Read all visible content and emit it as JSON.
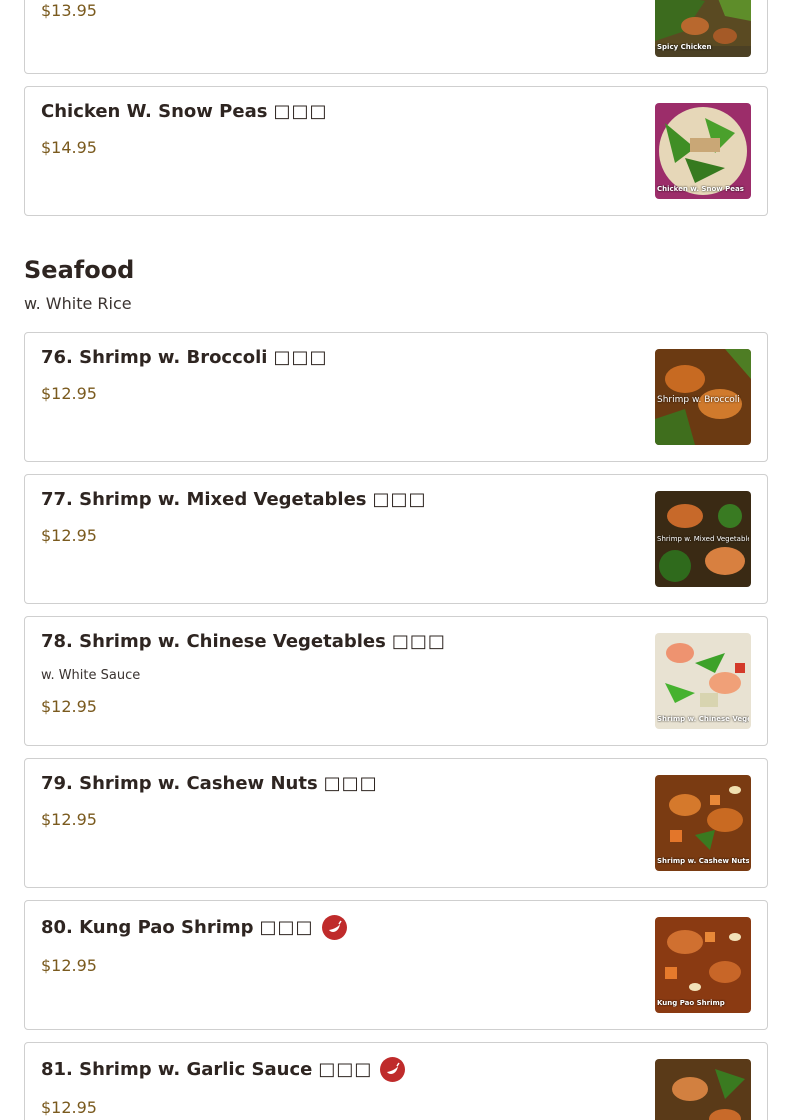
{
  "top_items": [
    {
      "name": "",
      "cjk": "",
      "price": "$13.95",
      "thumb_caption": "Spicy Chicken"
    },
    {
      "name": "Chicken W. Snow Peas",
      "cjk": "□□□",
      "price": "$14.95",
      "thumb_caption": "Chicken w. Snow Peas"
    }
  ],
  "section": {
    "title": "Seafood",
    "subtitle": "w. White Rice"
  },
  "items": [
    {
      "name": "76. Shrimp w. Broccoli",
      "cjk": "□□□",
      "desc": "",
      "price": "$12.95",
      "spicy": false,
      "thumb_caption": "Shrimp w. Broccoli"
    },
    {
      "name": "77. Shrimp w. Mixed Vegetables",
      "cjk": "□□□",
      "desc": "",
      "price": "$12.95",
      "spicy": false,
      "thumb_caption": "Shrimp w. Mixed Vegetables"
    },
    {
      "name": "78. Shrimp w. Chinese Vegetables",
      "cjk": "□□□",
      "desc": "w. White Sauce",
      "price": "$12.95",
      "spicy": false,
      "thumb_caption": "Shrimp w. Chinese Vegetables"
    },
    {
      "name": "79. Shrimp w. Cashew Nuts",
      "cjk": "□□□",
      "desc": "",
      "price": "$12.95",
      "spicy": false,
      "thumb_caption": "Shrimp w. Cashew Nuts"
    },
    {
      "name": "80. Kung Pao Shrimp",
      "cjk": "□□□",
      "desc": "",
      "price": "$12.95",
      "spicy": true,
      "thumb_caption": "Kung Pao Shrimp"
    },
    {
      "name": "81. Shrimp w. Garlic Sauce",
      "cjk": "□□□",
      "desc": "",
      "price": "$12.95",
      "spicy": true,
      "thumb_caption": ""
    }
  ],
  "colors": {
    "price": "#7a5a1e",
    "spicy_badge": "#bf2b2b",
    "border": "#cfcfcf"
  }
}
